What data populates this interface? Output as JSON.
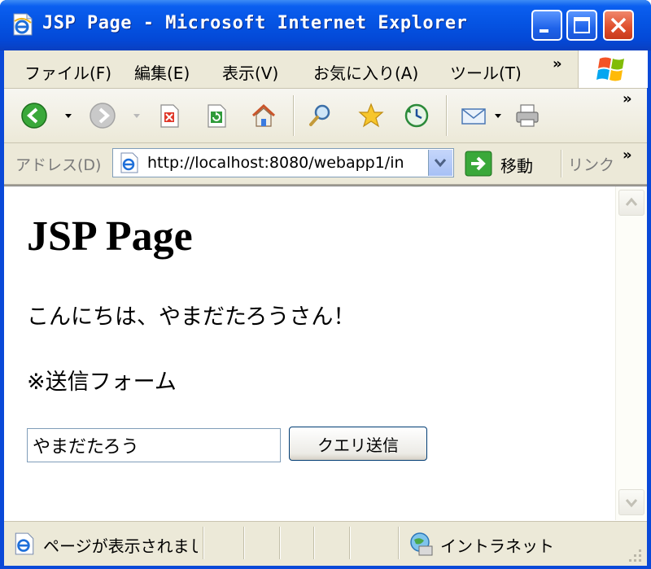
{
  "window": {
    "title": "JSP Page - Microsoft Internet Explorer"
  },
  "menu": {
    "items": [
      "ファイル(F)",
      "編集(E)",
      "表示(V)",
      "お気に入り(A)",
      "ツール(T)"
    ],
    "overflow": "»"
  },
  "toolbar": {
    "buttons": [
      "back-icon",
      "forward-icon",
      "stop-icon",
      "refresh-icon",
      "home-icon",
      "search-icon",
      "favorites-icon",
      "history-icon",
      "mail-icon",
      "print-icon"
    ],
    "overflow": "»"
  },
  "address": {
    "label": "アドレス(D)",
    "url": "http://localhost:8080/webapp1/in",
    "go_label": "移動",
    "links_label": "リンク",
    "overflow": "»"
  },
  "page": {
    "heading": "JSP Page",
    "greeting": "こんにちは、やまだたろうさん！",
    "form_label": "※送信フォーム",
    "input_value": "やまだたろう",
    "submit_label": "クエリ送信"
  },
  "status": {
    "text": "ページが表示されまし",
    "zone": "イントラネット"
  },
  "colors": {
    "titlebar": "#0554e3",
    "frame": "#ece9d8",
    "close_button": "#e0512f"
  }
}
